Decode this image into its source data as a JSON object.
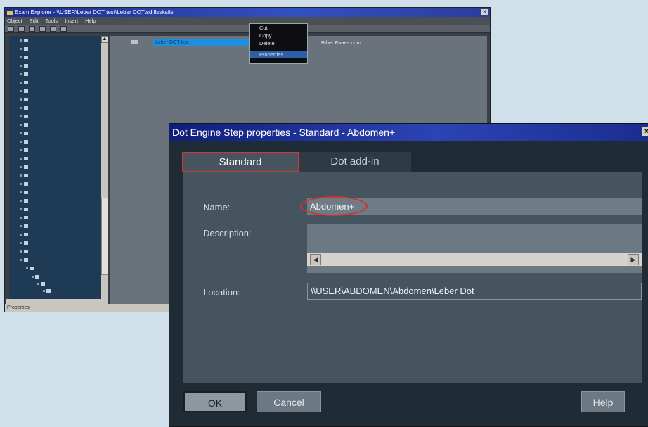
{
  "explorer": {
    "title": "Exam Explorer - \\\\USER\\Leber DOT test\\Leber DOT\\sdjflsskaflsl",
    "menu": [
      "Object",
      "Edit",
      "Tools",
      "Insert",
      "Help"
    ],
    "selected_item": "Leber DOT test",
    "second_column": "Biber Faaes.com",
    "status": "Properties",
    "context_menu": {
      "items": [
        "Cut",
        "Copy",
        "Delete"
      ],
      "selected": "Properties"
    }
  },
  "dialog": {
    "title": "Dot Engine Step properties - Standard - Abdomen+",
    "close_label": "×",
    "tabs": [
      {
        "label": "Standard",
        "active": true
      },
      {
        "label": "Dot add-in",
        "active": false
      }
    ],
    "fields": {
      "name_label": "Name:",
      "name_value": "Abdomen+",
      "description_label": "Description:",
      "description_value": "",
      "location_label": "Location:",
      "location_value": "\\\\USER\\ABDOMEN\\Abdomen\\Leber Dot"
    },
    "buttons": {
      "ok_label": "OK",
      "cancel_label": "Cancel",
      "help_label": "Help"
    }
  },
  "colors": {
    "highlight_red": "#d2322c",
    "titlebar_blue": "#2c44b4",
    "panel_gray": "#46545f",
    "background": "#cfe0ea"
  }
}
